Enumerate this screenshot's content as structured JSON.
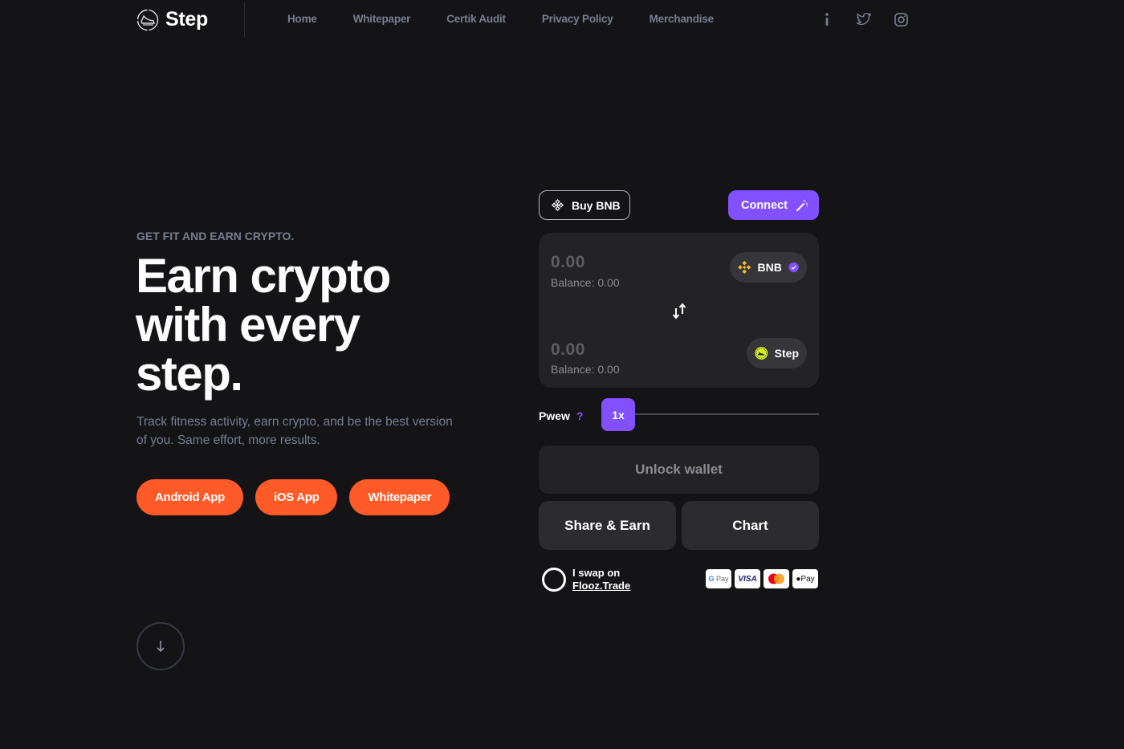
{
  "nav": {
    "brand": "Step",
    "links": [
      "Home",
      "Whitepaper",
      "Certik Audit",
      "Privacy Policy",
      "Merchandise"
    ],
    "icons": [
      "info-icon",
      "twitter-icon",
      "instagram-icon"
    ]
  },
  "hero": {
    "eyebrow": "GET FIT AND EARN CRYPTO.",
    "title_line1": "Earn crypto",
    "title_line2": "with every",
    "title_line3": "step.",
    "subtitle": "Track fitness activity, earn crypto, and be the best version of you. Same effort, more results.",
    "buttons": [
      "Android App",
      "iOS App",
      "Whitepaper"
    ],
    "accent_color": "#ff5a27"
  },
  "swap": {
    "buy_label": "Buy BNB",
    "connect_label": "Connect",
    "from": {
      "amount": "0.00",
      "balance": "Balance: 0.00",
      "token": "BNB"
    },
    "to": {
      "amount": "0.00",
      "balance": "Balance: 0.00",
      "token": "Step"
    },
    "pwew_label": "Pwew",
    "pwew_help": "?",
    "pwew_value": "1x",
    "unlock_label": "Unlock wallet",
    "share_label": "Share & Earn",
    "chart_label": "Chart",
    "flooz_line1": "I swap on",
    "flooz_link": "Flooz.Trade",
    "payment_methods": [
      "G Pay",
      "VISA",
      "Mastercard",
      "Apple Pay"
    ],
    "accent_color": "#8250ff"
  }
}
